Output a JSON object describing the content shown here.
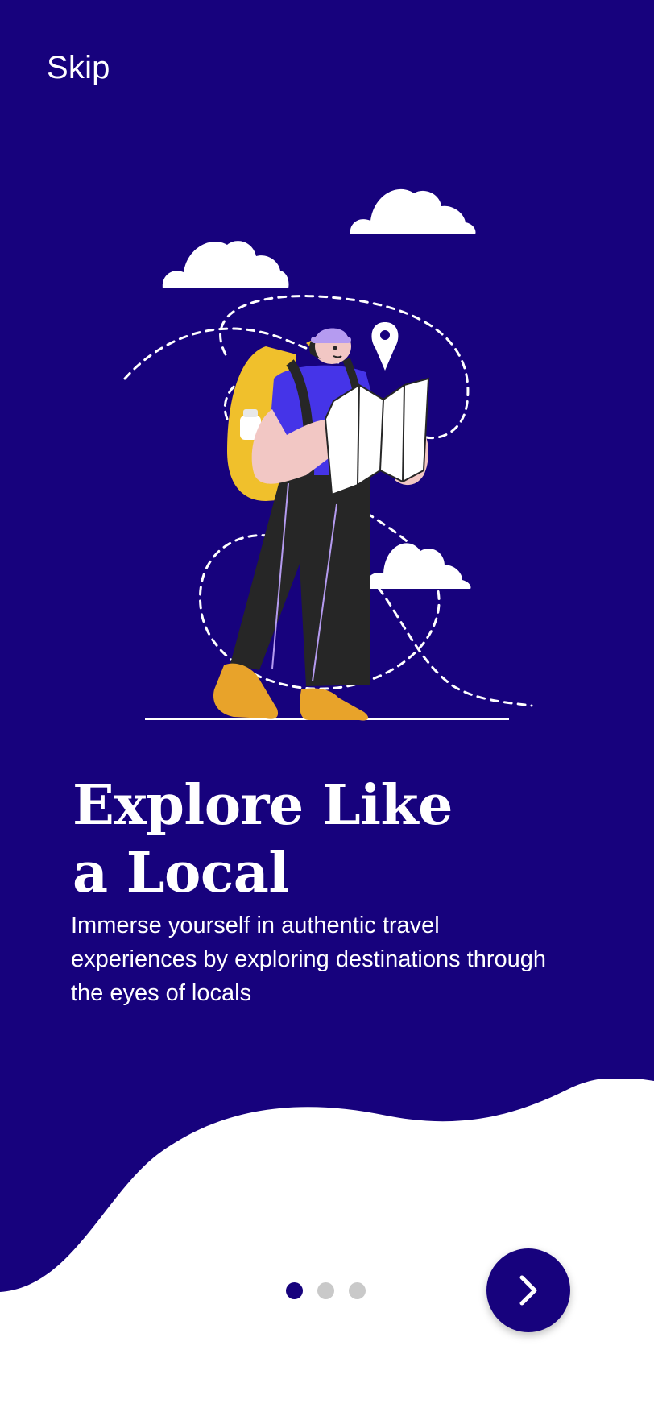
{
  "header": {
    "skip_label": "Skip"
  },
  "onboarding": {
    "title_line1": "Explore Like",
    "title_line2": "a Local",
    "description": "Immerse yourself in authentic travel experiences by exploring destinations through the eyes of locals"
  },
  "pagination": {
    "total": 3,
    "active_index": 0
  },
  "next_button": {
    "icon": "chevron-right-icon"
  },
  "colors": {
    "primary": "#17027d",
    "background_bottom": "#ffffff",
    "inactive_dot": "#c9c9c9",
    "backpack": "#f0c02c",
    "shirt": "#4534e8",
    "hat": "#b59bf0"
  }
}
